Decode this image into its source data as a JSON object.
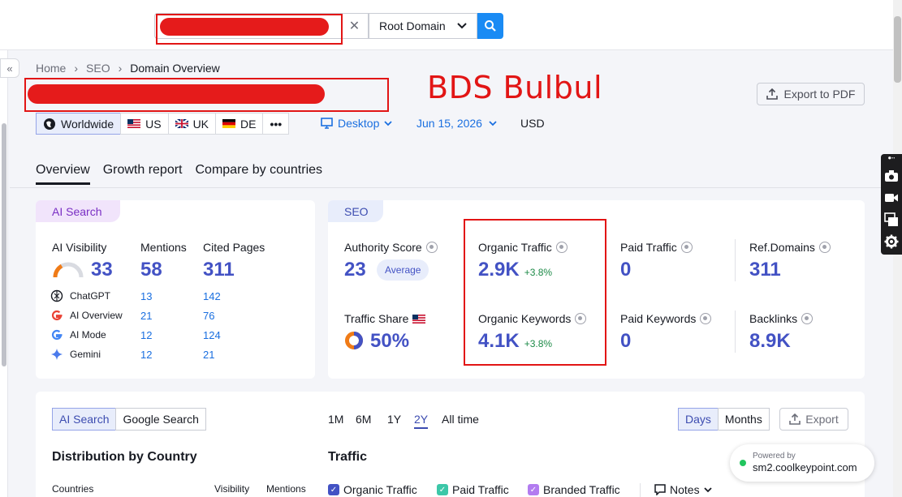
{
  "search": {
    "domain_type": "Root Domain",
    "clear_symbol": "✕"
  },
  "breadcrumb": {
    "items": [
      "Home",
      "SEO",
      "Domain Overview"
    ]
  },
  "annotation": {
    "label": "BDS Bulbul",
    "color": "#e21515"
  },
  "header": {
    "export_pdf": "Export to PDF"
  },
  "regions": {
    "items": [
      "Worldwide",
      "US",
      "UK",
      "DE"
    ],
    "more": "•••"
  },
  "filters": {
    "device": "Desktop",
    "date": "Jun 15, 2026",
    "currency": "USD"
  },
  "tabs": {
    "items": [
      "Overview",
      "Growth report",
      "Compare by countries"
    ],
    "active": "Overview"
  },
  "ai_search": {
    "tag": "AI Search",
    "visibility_label": "AI Visibility",
    "visibility_value": "33",
    "mentions_label": "Mentions",
    "mentions_value": "58",
    "cited_label": "Cited Pages",
    "cited_value": "311",
    "sources": [
      {
        "name": "ChatGPT",
        "mentions": "13",
        "cited": "142"
      },
      {
        "name": "AI Overview",
        "mentions": "21",
        "cited": "76"
      },
      {
        "name": "AI Mode",
        "mentions": "12",
        "cited": "124"
      },
      {
        "name": "Gemini",
        "mentions": "12",
        "cited": "21"
      }
    ]
  },
  "seo": {
    "tag": "SEO",
    "authority_label": "Authority Score",
    "authority_value": "23",
    "authority_badge": "Average",
    "traffic_share_label": "Traffic Share",
    "traffic_share_value": "50%",
    "organic_traffic_label": "Organic Traffic",
    "organic_traffic_value": "2.9K",
    "organic_traffic_delta": "+3.8%",
    "organic_keywords_label": "Organic Keywords",
    "organic_keywords_value": "4.1K",
    "organic_keywords_delta": "+3.8%",
    "paid_traffic_label": "Paid Traffic",
    "paid_traffic_value": "0",
    "paid_keywords_label": "Paid Keywords",
    "paid_keywords_value": "0",
    "ref_domains_label": "Ref.Domains",
    "ref_domains_value": "311",
    "backlinks_label": "Backlinks",
    "backlinks_value": "8.9K"
  },
  "bottom": {
    "source_tabs": [
      "AI Search",
      "Google Search"
    ],
    "ranges": [
      "1M",
      "6M",
      "1Y",
      "2Y",
      "All time"
    ],
    "active_range": "2Y",
    "granularity": [
      "Days",
      "Months"
    ],
    "export": "Export",
    "distribution_title": "Distribution by Country",
    "traffic_title": "Traffic",
    "col_countries": "Countries",
    "col_visibility": "Visibility",
    "col_mentions": "Mentions",
    "legend": [
      "Organic Traffic",
      "Paid Traffic",
      "Branded Traffic"
    ],
    "notes": "Notes"
  },
  "powered": {
    "small": "Powered by",
    "url": "sm2.coolkeypoint.com"
  },
  "colors": {
    "accent": "#4352c4",
    "link": "#1a6fe0",
    "positive": "#1c8a47",
    "search_button": "#1a8bf4"
  }
}
